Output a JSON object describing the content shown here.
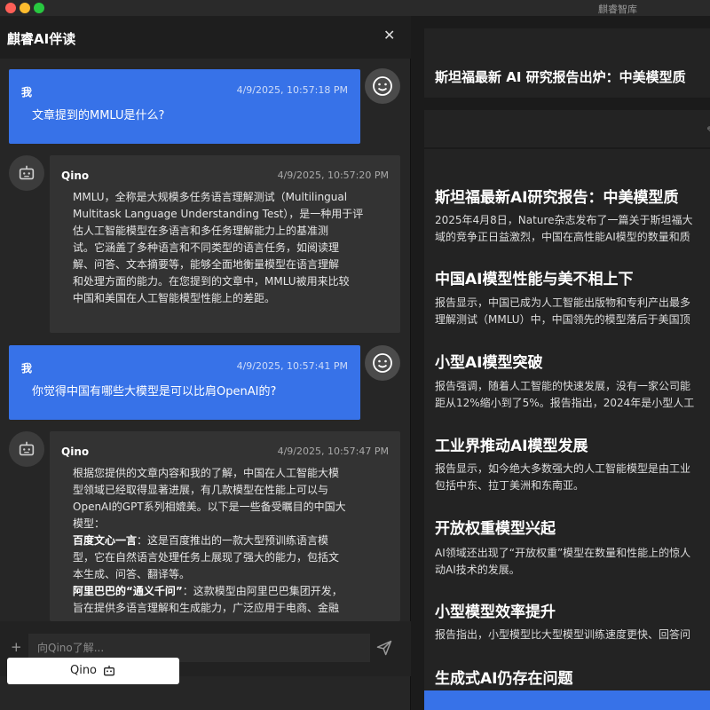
{
  "window": {
    "title": "麒睿智库"
  },
  "chat": {
    "title": "麒睿AI伴读",
    "messages": [
      {
        "sender": "我",
        "time": "4/9/2025, 10:57:18 PM",
        "text": "文章提到的MMLU是什么?"
      },
      {
        "sender": "Qino",
        "time": "4/9/2025, 10:57:20 PM",
        "lines": [
          "MMLU，全称是大规模多任务语言理解测试（Multilingual",
          "Multitask Language Understanding Test），是一种用于评",
          "估人工智能模型在多语言和多任务理解能力上的基准测",
          "试。它涵盖了多种语言和不同类型的语言任务，如阅读理",
          "解、问答、文本摘要等，能够全面地衡量模型在语言理解",
          "和处理方面的能力。在您提到的文章中，MMLU被用来比较",
          "中国和美国在人工智能模型性能上的差距。"
        ]
      },
      {
        "sender": "我",
        "time": "4/9/2025, 10:57:41 PM",
        "text": "你觉得中国有哪些大模型是可以比肩OpenAI的?"
      },
      {
        "sender": "Qino",
        "time": "4/9/2025, 10:57:47 PM",
        "lines": [
          "根据您提供的文章内容和我的了解，中国在人工智能大模",
          "型领域已经取得显著进展，有几款模型在性能上可以与",
          "OpenAI的GPT系列相媲美。以下是一些备受瞩目的中国大",
          "模型："
        ],
        "items": [
          {
            "name": "百度文心一言",
            "lines": [
              "：这是百度推出的一款大型预训练语言模",
              "型，它在自然语言处理任务上展现了强大的能力，包括文",
              "本生成、问答、翻译等。"
            ]
          },
          {
            "name": "阿里巴巴的“通义千问”",
            "lines": [
              "：这款模型由阿里巴巴集团开发，",
              "旨在提供多语言理解和生成能力，广泛应用于电商、金融"
            ]
          }
        ]
      }
    ],
    "input": {
      "placeholder": "向Qino了解..."
    },
    "qino_button": "Qino"
  },
  "article": {
    "header_title": "斯坦福最新 AI 研究报告出炉：中美模型质",
    "title": "斯坦福最新AI研究报告：中美模型质",
    "intro": [
      "2025年4月8日，Nature杂志发布了一篇关于斯坦福大",
      "域的竞争正日益激烈，中国在高性能AI模型的数量和质"
    ],
    "sections": [
      {
        "heading": "中国AI模型性能与美不相上下",
        "lines": [
          "报告显示，中国已成为人工智能出版物和专利产出最多",
          "理解测试（MMLU）中，中国领先的模型落后于美国顶"
        ]
      },
      {
        "heading": "小型AI模型突破",
        "lines": [
          "报告强调，随着人工智能的快速发展，没有一家公司能",
          "距从12%缩小到了5%。报告指出，2024年是小型人工"
        ]
      },
      {
        "heading": "工业界推动AI模型发展",
        "lines": [
          "报告显示，如今绝大多数强大的人工智能模型是由工业",
          "包括中东、拉丁美洲和东南亚。"
        ]
      },
      {
        "heading": "开放权重模型兴起",
        "lines": [
          "AI领域还出现了“开放权重”模型在数量和性能上的惊人",
          "动AI技术的发展。"
        ]
      },
      {
        "heading": "小型模型效率提升",
        "lines": [
          "报告指出，小型模型比大型模型训练速度更快、回答问"
        ]
      },
      {
        "heading": "生成式AI仍存在问题",
        "lines": []
      }
    ]
  },
  "icons": {
    "close": "close-icon",
    "plus": "plus-icon",
    "send": "send-icon",
    "user_avatar": "smiley-face-icon",
    "bot_avatar": "robot-icon",
    "edit": "pencil-icon"
  },
  "colors": {
    "accent": "#3772e8",
    "panel": "#262626",
    "bubble": "#333333"
  }
}
